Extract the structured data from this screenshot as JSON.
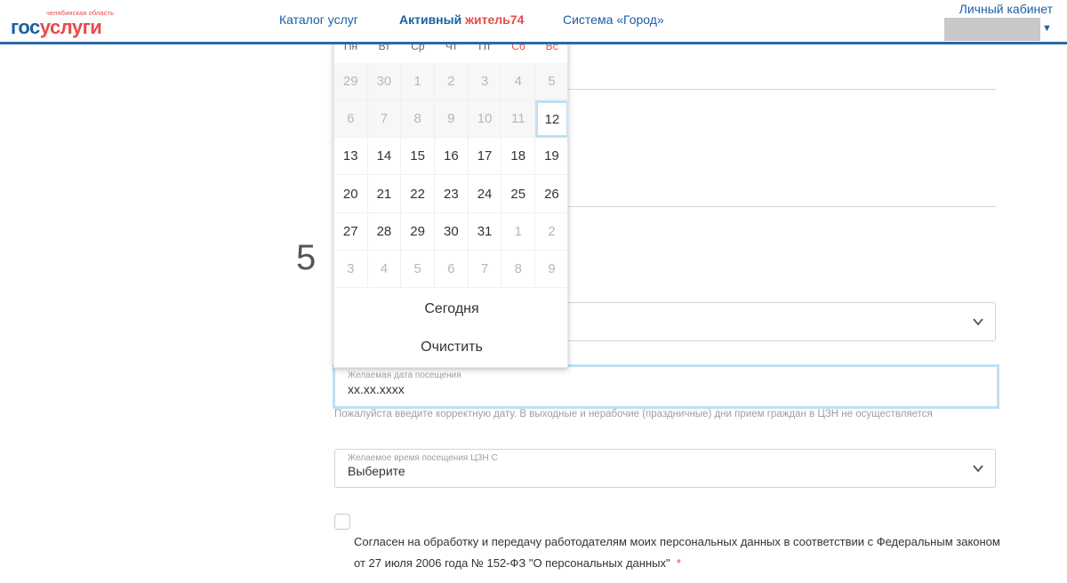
{
  "header": {
    "logo_region": "челябинская область",
    "logo_gos": "гос",
    "logo_uslugi": "услуги",
    "nav_catalog": "Каталог услуг",
    "nav_active_a": "Активный ",
    "nav_active_b": "житель74",
    "nav_city": "Система «Город»",
    "cabinet": "Личный кабинет"
  },
  "step": "5",
  "calendar": {
    "weekdays": [
      "Пн",
      "Вт",
      "Ср",
      "Чт",
      "Пт",
      "Сб",
      "Вс"
    ],
    "rows": [
      [
        "29",
        "30",
        "1",
        "2",
        "3",
        "4",
        "5"
      ],
      [
        "6",
        "7",
        "8",
        "9",
        "10",
        "11",
        "12"
      ],
      [
        "13",
        "14",
        "15",
        "16",
        "17",
        "18",
        "19"
      ],
      [
        "20",
        "21",
        "22",
        "23",
        "24",
        "25",
        "26"
      ],
      [
        "27",
        "28",
        "29",
        "30",
        "31",
        "1",
        "2"
      ],
      [
        "3",
        "4",
        "5",
        "6",
        "7",
        "8",
        "9"
      ]
    ],
    "today_button": "Сегодня",
    "clear_button": "Очистить"
  },
  "form": {
    "date_label": "Желаемая дата посещения",
    "date_value": "xx.xx.xxxx",
    "date_hint": "Пожалуйста введите корректную дату. В выходные и нерабочие (праздничные) дни прием граждан в ЦЗН не осуществляется",
    "time_label": "Желаемое время посещения ЦЗН С",
    "time_value": "Выберите",
    "consent_text": "Согласен на обработку и передачу работодателям моих персональных данных в соответствии с Федеральным законом от 27 июля 2006 года № 152-ФЗ \"О персональных данных\"",
    "required_mark": "*"
  },
  "colors": {
    "brand_blue": "#1b5ea6",
    "brand_red": "#e84a4a",
    "focus_border": "#bfe0f3"
  }
}
